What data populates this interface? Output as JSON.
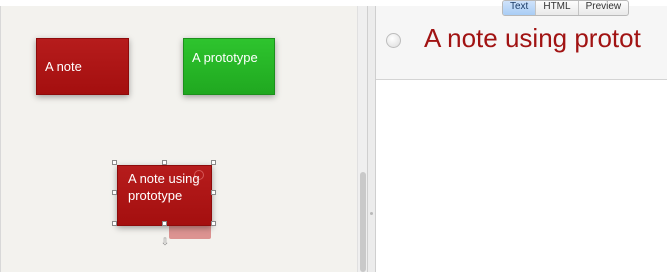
{
  "canvas": {
    "notes": [
      {
        "text": "A note",
        "color": "#ad1515"
      },
      {
        "text": "A prototype",
        "color": "#27b827"
      },
      {
        "text": "A note using prototype",
        "color": "#ad1515"
      }
    ]
  },
  "editor": {
    "tabs": [
      {
        "label": "Text",
        "active": true
      },
      {
        "label": "HTML",
        "active": false
      },
      {
        "label": "Preview",
        "active": false
      }
    ],
    "title": "A note using protot"
  }
}
